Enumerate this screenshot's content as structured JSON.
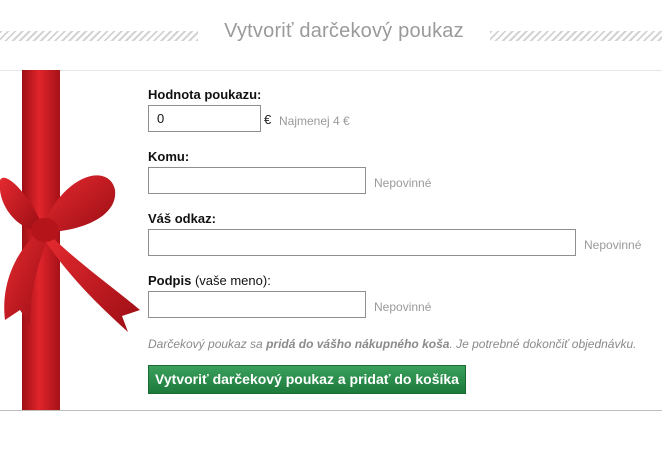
{
  "header": {
    "title": "Vytvoriť darčekový poukaz"
  },
  "form": {
    "value_label": "Hodnota poukazu:",
    "value_input": "0",
    "currency": "€",
    "value_hint": "Najmenej 4 €",
    "to_label": "Komu:",
    "to_hint": "Nepovinné",
    "message_label": "Váš odkaz:",
    "message_hint": "Nepovinné",
    "signature_label_bold": "Podpis",
    "signature_label_rest": " (vaše meno):",
    "signature_hint": "Nepovinné",
    "note_part1": "Darčekový poukaz sa ",
    "note_bold": "pridá do vášho nákupného koša",
    "note_part2": ". Je potrebné dokončiť objednávku.",
    "submit_label": "Vytvoriť darčekový poukaz a pridať do košíka"
  },
  "colors": {
    "ribbon": "#c8161d",
    "button": "#1d7a3c",
    "hint": "#9a9a9a"
  }
}
